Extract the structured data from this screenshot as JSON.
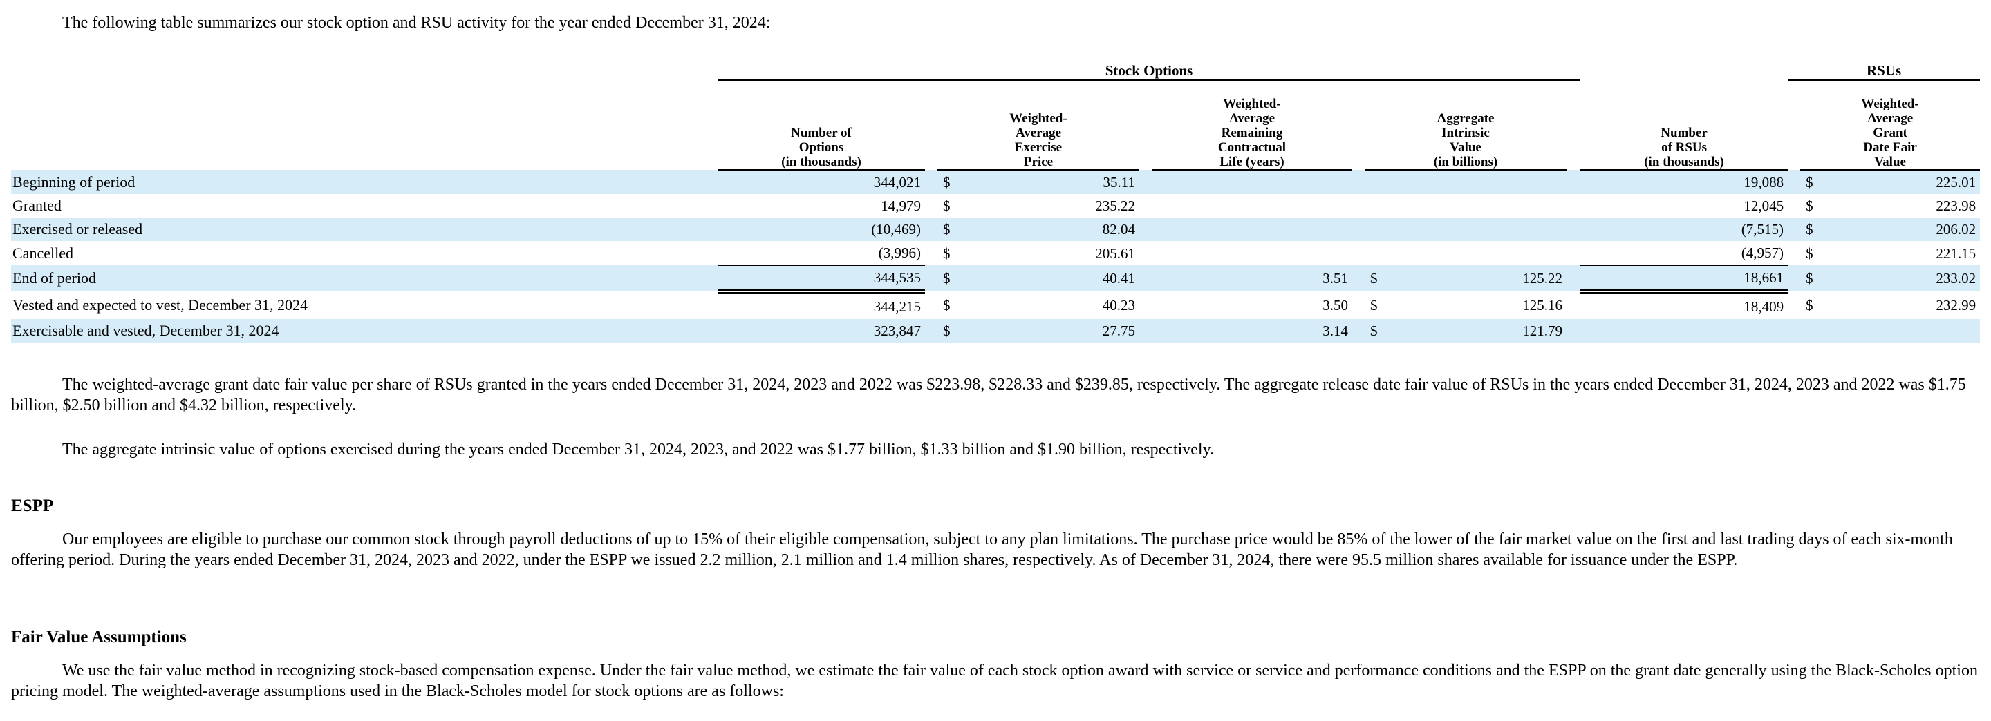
{
  "intro": "The following table summarizes our stock option and RSU activity for the year ended December 31, 2024:",
  "table": {
    "group_headers": {
      "stock_options": "Stock Options",
      "rsus": "RSUs"
    },
    "headers": {
      "num_options": "Number of\nOptions\n(in thousands)",
      "wa_exercise_price": "Weighted-\nAverage\nExercise\nPrice",
      "wa_remaining_life": "Weighted-\nAverage\nRemaining\nContractual\nLife (years)",
      "aggregate_intrinsic": "Aggregate\nIntrinsic\nValue\n(in billions)",
      "num_rsus": "Number\nof RSUs\n(in thousands)",
      "wa_grant_fair_value": "Weighted-\nAverage\nGrant\nDate Fair\nValue"
    },
    "currency_symbol": "$",
    "rows": [
      {
        "label": "Beginning of period",
        "options": "344,021",
        "exercise_price": "35.11",
        "life": "",
        "intrinsic": "",
        "rsus": "19,088",
        "grant_fv": "225.01"
      },
      {
        "label": "Granted",
        "options": "14,979",
        "exercise_price": "235.22",
        "life": "",
        "intrinsic": "",
        "rsus": "12,045",
        "grant_fv": "223.98"
      },
      {
        "label": "Exercised or released",
        "options": "(10,469)",
        "exercise_price": "82.04",
        "life": "",
        "intrinsic": "",
        "rsus": "(7,515)",
        "grant_fv": "206.02"
      },
      {
        "label": "Cancelled",
        "options": "(3,996)",
        "exercise_price": "205.61",
        "life": "",
        "intrinsic": "",
        "rsus": "(4,957)",
        "grant_fv": "221.15"
      },
      {
        "label": "End of period",
        "options": "344,535",
        "exercise_price": "40.41",
        "life": "3.51",
        "intrinsic": "125.22",
        "rsus": "18,661",
        "grant_fv": "233.02"
      },
      {
        "label": "Vested and expected to vest, December 31, 2024",
        "options": "344,215",
        "exercise_price": "40.23",
        "life": "3.50",
        "intrinsic": "125.16",
        "rsus": "18,409",
        "grant_fv": "232.99"
      },
      {
        "label": "Exercisable and vested, December 31, 2024",
        "options": "323,847",
        "exercise_price": "27.75",
        "life": "3.14",
        "intrinsic": "121.79",
        "rsus": "",
        "grant_fv": ""
      }
    ]
  },
  "para_rsu_fair_value": "The weighted-average grant date fair value per share of RSUs granted in the years ended December 31, 2024, 2023 and 2022 was $223.98, $228.33 and $239.85, respectively. The aggregate release date fair value of RSUs in the years ended December 31, 2024, 2023 and 2022 was $1.75 billion, $2.50 billion and $4.32 billion, respectively.",
  "para_intrinsic": "The aggregate intrinsic value of options exercised during the years ended December 31, 2024, 2023, and 2022 was $1.77 billion, $1.33 billion and $1.90 billion, respectively.",
  "espp_heading": "ESPP",
  "espp_text": "Our employees are eligible to purchase our common stock through payroll deductions of up to 15% of their eligible compensation, subject to any plan limitations. The purchase price would be 85% of the lower of the fair market value on the first and last trading days of each six-month offering period. During the years ended December 31, 2024, 2023 and 2022, under the ESPP we issued 2.2 million, 2.1 million and 1.4 million shares, respectively. As of December 31, 2024, there were 95.5 million shares available for issuance under the ESPP.",
  "fva_heading": "Fair Value Assumptions",
  "fva_text": "We use the fair value method in recognizing stock-based compensation expense. Under the fair value method, we estimate the fair value of each stock option award with service or service and performance conditions and the ESPP on the grant date generally using the Black-Scholes option pricing model. The weighted-average assumptions used in the Black-Scholes model for stock options are as follows:"
}
